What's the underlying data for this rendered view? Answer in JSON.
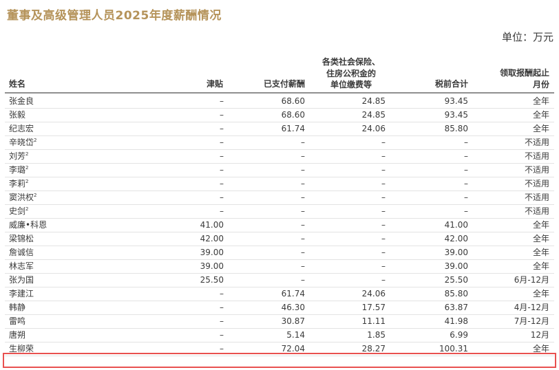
{
  "title": "董事及高级管理人员2025年度薪酬情况",
  "unit": "单位：万元",
  "columns": {
    "name": "姓名",
    "allowance": "津贴",
    "paid_salary": "已支付薪酬",
    "social_insurance": [
      "各类社会保险、",
      "住房公积金的",
      "单位缴费等"
    ],
    "pretax_total": "税前合计",
    "period": [
      "领取报酬起止",
      "月份"
    ]
  },
  "rows": [
    {
      "name": "张金良",
      "note": "",
      "allowance": "–",
      "paid_salary": "68.60",
      "social_insurance": "24.85",
      "pretax_total": "93.45",
      "period": "全年"
    },
    {
      "name": "张毅",
      "note": "",
      "allowance": "–",
      "paid_salary": "68.60",
      "social_insurance": "24.85",
      "pretax_total": "93.45",
      "period": "全年"
    },
    {
      "name": "纪志宏",
      "note": "",
      "allowance": "–",
      "paid_salary": "61.74",
      "social_insurance": "24.06",
      "pretax_total": "85.80",
      "period": "全年"
    },
    {
      "name": "辛晓岱",
      "note": "2",
      "allowance": "–",
      "paid_salary": "–",
      "social_insurance": "–",
      "pretax_total": "–",
      "period": "不适用"
    },
    {
      "name": "刘芳",
      "note": "2",
      "allowance": "–",
      "paid_salary": "–",
      "social_insurance": "–",
      "pretax_total": "–",
      "period": "不适用"
    },
    {
      "name": "李璐",
      "note": "2",
      "allowance": "–",
      "paid_salary": "–",
      "social_insurance": "–",
      "pretax_total": "–",
      "period": "不适用"
    },
    {
      "name": "李莉",
      "note": "2",
      "allowance": "–",
      "paid_salary": "–",
      "social_insurance": "–",
      "pretax_total": "–",
      "period": "不适用"
    },
    {
      "name": "窦洪权",
      "note": "2",
      "allowance": "–",
      "paid_salary": "–",
      "social_insurance": "–",
      "pretax_total": "–",
      "period": "不适用"
    },
    {
      "name": "史剑",
      "note": "2",
      "allowance": "–",
      "paid_salary": "–",
      "social_insurance": "–",
      "pretax_total": "–",
      "period": "不适用"
    },
    {
      "name": "威廉•科恩",
      "note": "",
      "allowance": "41.00",
      "paid_salary": "–",
      "social_insurance": "–",
      "pretax_total": "41.00",
      "period": "全年"
    },
    {
      "name": "梁锦松",
      "note": "",
      "allowance": "42.00",
      "paid_salary": "–",
      "social_insurance": "–",
      "pretax_total": "42.00",
      "period": "全年"
    },
    {
      "name": "詹诚信",
      "note": "",
      "allowance": "39.00",
      "paid_salary": "–",
      "social_insurance": "–",
      "pretax_total": "39.00",
      "period": "全年"
    },
    {
      "name": "林志军",
      "note": "",
      "allowance": "39.00",
      "paid_salary": "–",
      "social_insurance": "–",
      "pretax_total": "39.00",
      "period": "全年"
    },
    {
      "name": "张为国",
      "note": "",
      "allowance": "25.50",
      "paid_salary": "–",
      "social_insurance": "–",
      "pretax_total": "25.50",
      "period": "6月-12月"
    },
    {
      "name": "李建江",
      "note": "",
      "allowance": "–",
      "paid_salary": "61.74",
      "social_insurance": "24.06",
      "pretax_total": "85.80",
      "period": "全年"
    },
    {
      "name": "韩静",
      "note": "",
      "allowance": "–",
      "paid_salary": "46.30",
      "social_insurance": "17.57",
      "pretax_total": "63.87",
      "period": "4月-12月"
    },
    {
      "name": "雷鸣",
      "note": "",
      "allowance": "–",
      "paid_salary": "30.87",
      "social_insurance": "11.11",
      "pretax_total": "41.98",
      "period": "7月-12月"
    },
    {
      "name": "唐朔",
      "note": "",
      "allowance": "–",
      "paid_salary": "5.14",
      "social_insurance": "1.85",
      "pretax_total": "6.99",
      "period": "12月"
    },
    {
      "name": "生柳荣",
      "note": "",
      "allowance": "–",
      "paid_salary": "72.04",
      "social_insurance": "28.27",
      "pretax_total": "100.31",
      "period": "全年"
    }
  ],
  "highlight_color": "#e8504f",
  "title_color": "#b5935a"
}
